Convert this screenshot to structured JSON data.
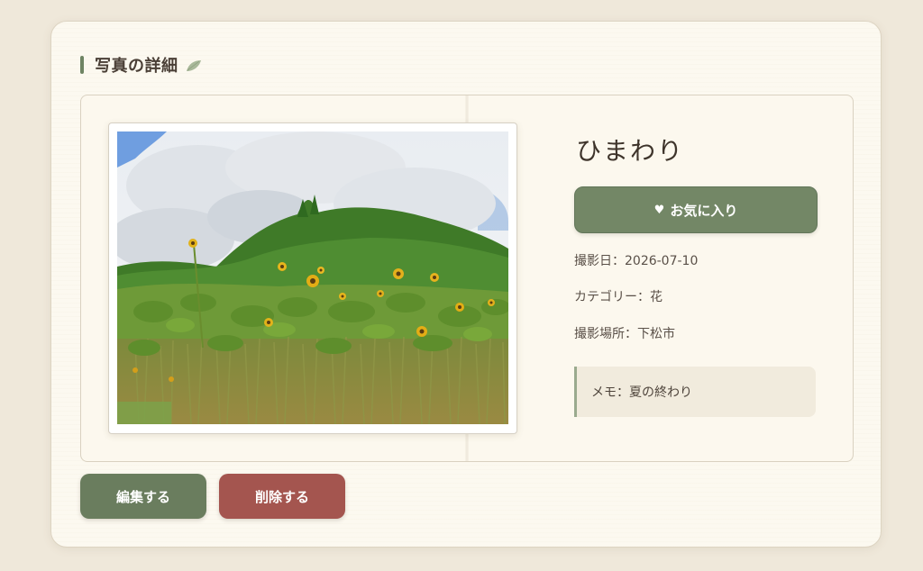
{
  "header": {
    "title": "写真の詳細",
    "icon": "leaf-icon"
  },
  "photo": {
    "name": "ひまわり",
    "image_alt": "sunflower field photo"
  },
  "favorite": {
    "icon": "heart-icon",
    "label": "お気に入り"
  },
  "details": {
    "date": "撮影日：2026-07-10",
    "category": "カテゴリー：花",
    "location": "撮影場所：下松市"
  },
  "memo": {
    "text": "メモ：夏の終わり"
  },
  "actions": {
    "edit_label": "編集する",
    "delete_label": "削除する"
  },
  "colors": {
    "accent": "#738766",
    "danger": "#a4554f",
    "background": "#efe8da",
    "card": "#fcf9f0"
  }
}
